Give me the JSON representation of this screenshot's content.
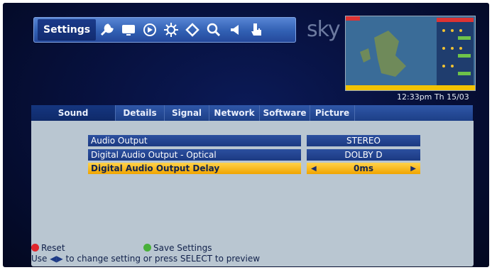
{
  "toolbar": {
    "active_label": "Settings",
    "icons": [
      "wrench-icon",
      "tv-icon",
      "disc-icon",
      "burst-icon",
      "tag-icon",
      "search-icon",
      "speaker-icon",
      "hand-icon"
    ]
  },
  "brand": {
    "logo_text": "sky"
  },
  "clock": {
    "time": "12:33pm Th 15/03"
  },
  "tabs": [
    "Sound",
    "Details",
    "Signal",
    "Network",
    "Software",
    "Picture"
  ],
  "active_tab": "Sound",
  "settings": [
    {
      "label": "Audio Output",
      "value": "STEREO"
    },
    {
      "label": "Digital Audio Output - Optical",
      "value": "DOLBY D"
    },
    {
      "label": "Digital Audio Output Delay",
      "value": "0ms"
    }
  ],
  "footer": {
    "reset_label": "Reset",
    "save_label": "Save Settings",
    "hint_prefix": "Use",
    "hint_text": "to change setting or press SELECT to preview"
  },
  "colors": {
    "highlight": "#f0a400",
    "red_button": "#e0252b",
    "green_button": "#48b03a"
  }
}
